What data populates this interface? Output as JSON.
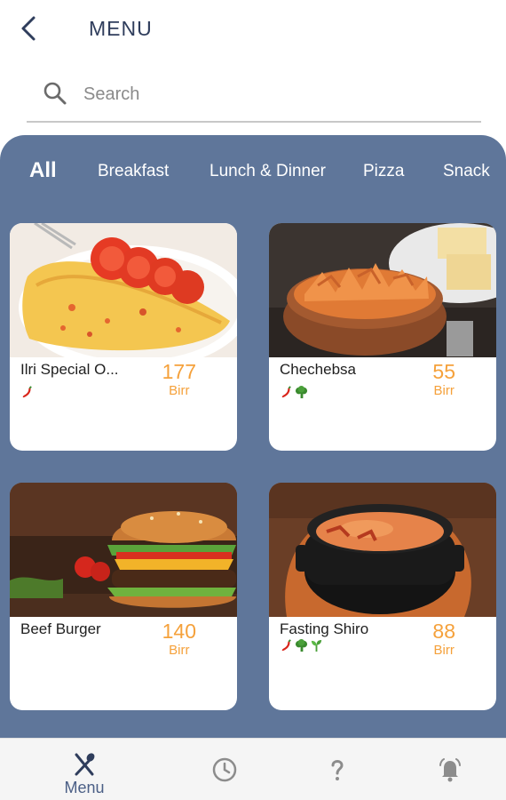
{
  "header": {
    "back_icon": "chevron-left-icon",
    "title": "MENU"
  },
  "search": {
    "icon": "search-icon",
    "placeholder": "Search",
    "value": ""
  },
  "tabs": [
    {
      "label": "All",
      "active": true
    },
    {
      "label": "Breakfast",
      "active": false
    },
    {
      "label": "Lunch & Dinner",
      "active": false
    },
    {
      "label": "Pizza",
      "active": false
    },
    {
      "label": "Snack",
      "active": false
    }
  ],
  "menu_items": [
    {
      "name": "Ilri Special O...",
      "price": "177",
      "currency": "Birr",
      "tags": [
        "chili-icon"
      ],
      "image": "omelette"
    },
    {
      "name": "Chechebsa",
      "price": "55",
      "currency": "Birr",
      "tags": [
        "chili-icon",
        "broccoli-icon"
      ],
      "image": "chechebsa"
    },
    {
      "name": "Beef Burger",
      "price": "140",
      "currency": "Birr",
      "tags": [],
      "image": "burger"
    },
    {
      "name": "Fasting Shiro",
      "price": "88",
      "currency": "Birr",
      "tags": [
        "chili-icon",
        "broccoli-icon",
        "sprout-icon"
      ],
      "image": "shiro"
    }
  ],
  "bottom_nav": [
    {
      "label": "Menu",
      "icon": "utensils-icon",
      "active": true
    },
    {
      "label": "",
      "icon": "clock-icon",
      "active": false
    },
    {
      "label": "",
      "icon": "question-icon",
      "active": false
    },
    {
      "label": "",
      "icon": "bell-icon",
      "active": false
    }
  ],
  "colors": {
    "panel": "#5f769a",
    "price": "#f5a13b",
    "title": "#2f3d5c",
    "nav_active": "#2f3d5c",
    "nav_inactive": "#8c8c8c"
  }
}
